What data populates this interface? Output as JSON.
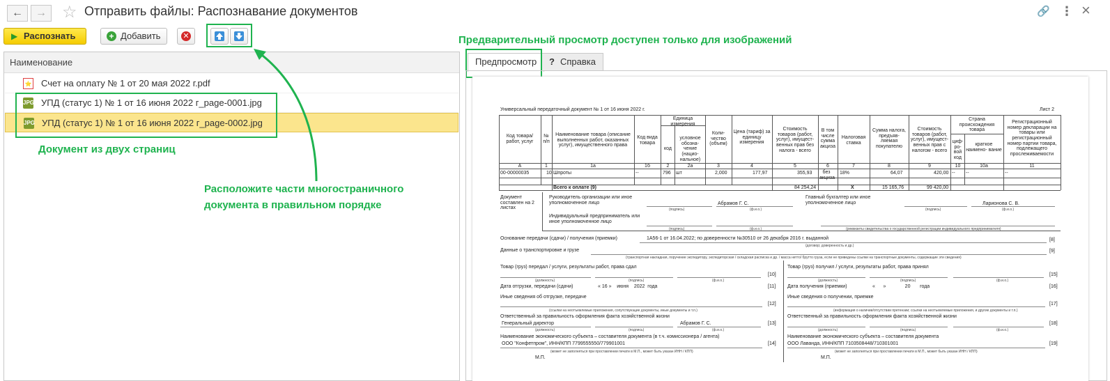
{
  "window": {
    "title": "Отправить файлы: Распознавание документов",
    "back_icon": "←",
    "forward_icon": "→",
    "star_icon": "☆",
    "link_icon": "🔗",
    "menu_icon": "⋮",
    "close_icon": "×"
  },
  "toolbar": {
    "recognize_label": "Распознать",
    "add_label": "Добавить"
  },
  "list": {
    "column_header": "Наименование",
    "rows": [
      {
        "name": "Счет на оплату № 1 от 20 мая 2022 г.pdf",
        "type": "pdf"
      },
      {
        "name": "УПД (статус 1) № 1 от 16 июня 2022 г_page-0001.jpg",
        "type": "jpg"
      },
      {
        "name": "УПД (статус 1) № 1 от 16 июня 2022 г_page-0002.jpg",
        "type": "jpg"
      }
    ]
  },
  "annotations": {
    "two_pages": "Документ из двух страниц",
    "order_line1": "Расположите части многостраничного",
    "order_line2": "документа в правильном порядке",
    "preview_note": "Предварительный просмотр доступен только для изображений"
  },
  "tabs": {
    "preview": "Предпросмотр",
    "help_icon": "?",
    "help": "Справка"
  },
  "doc": {
    "title": "Универсальный передаточный документ № 1 от 16 июня 2022 г.",
    "sheet": "Лист 2",
    "headers": [
      "Код товара/ работ, услуг",
      "№ п/п",
      "Наименование товара (описание выполненных работ, оказанных услуг), имущественного права",
      "Код вида товара",
      "Единица измерения",
      "код",
      "условное обозна- чение (нацио- нальное)",
      "Коли- чество (объем)",
      "Цена (тариф) за единицу измерения",
      "Стоимость товаров (работ, услуг), имущест- венных прав без налога - всего",
      "В том числе сумма акциза",
      "Налоговая ставка",
      "Сумма налога, предъяв- ляемая покупателю",
      "Стоимость товаров (работ, услуг), имущест- венных прав с налогом - всего",
      "Страна происхождения товара",
      "циф- ро- вой код",
      "краткое наимено- вание",
      "Регистрационный номер декларации на товары или регистрационный номер партии товара, подлежащего прослеживаемости"
    ],
    "col_letters": [
      "А",
      "1",
      "1а",
      "1б",
      "2",
      "2а",
      "3",
      "4",
      "5",
      "6",
      "7",
      "8",
      "9",
      "10",
      "10а",
      "11"
    ],
    "row": [
      "00-00000035",
      "10",
      "Шпроты",
      "--",
      "796",
      "шт",
      "2,000",
      "177,97",
      "355,93",
      "без акциза",
      "18%",
      "64,07",
      "420,00",
      "--",
      "--",
      "--"
    ],
    "total_label": "Всего к оплате (9)",
    "total_values": [
      "84 254,24",
      "X",
      "15 165,76",
      "99 420,00"
    ],
    "sign_left": "Документ составлен на 2 листах",
    "head_org": "Руководитель организации или иное уполномоченное лицо",
    "head_name": "Абрамов Г. С.",
    "chief_acc": "Главный бухгалтер или иное уполномоченное лицо",
    "chief_name": "Ларионова С. В.",
    "ip": "Индивидуальный предприниматель или иное уполномоченное лицо",
    "podpis": "(подпись)",
    "fio": "(ф.и.о.)",
    "rekv": "(реквизиты свидетельства о государственной регистрации индивидуального предпринимателя)",
    "basis_label": "Основание передачи (сдачи) / получения (приемки)",
    "basis_value": "1А56-1 от 16.04.2022; по доверенности №30510 от 26 декабря 2016 г. выданной",
    "basis_note": "(договор; доверенность и др.)",
    "transport_label": "Данные о транспортировке и грузе",
    "transport_note": "(транспортная накладная, поручение экспедитору, экспедиторская / складская расписка и др. / масса нетто/ брутто груза, если не приведены ссылки на транспортные документы, содержащие эти сведения)",
    "n8": "[8]",
    "n9": "[9]",
    "n10": "[10]",
    "n11": "[11]",
    "n12": "[12]",
    "n13": "[13]",
    "n14": "[14]",
    "n15": "[15]",
    "n16": "[16]",
    "n17": "[17]",
    "n18": "[18]",
    "n19": "[19]",
    "given": "Товар (груз) передал / услуги, результаты работ, права сдал",
    "received": "Товар (груз) получил / услуги, результаты работ, права принял",
    "dolzh": "(должность)",
    "ship_date_label": "Дата отгрузки, передачи (сдачи)",
    "ship_date_value": "« 16 »    июня    2022  года",
    "recv_date_label": "Дата получения (приемки)",
    "recv_date_value": "«      »              20       года",
    "other_ship": "Иные сведения об отгрузке, передаче",
    "other_ship_note": "(ссылки на неотъемлемые приложения, сопутствующие документы, иные документы и т.п.)",
    "other_recv": "Иные сведения о получении, приемке",
    "other_recv_note": "(информация о наличии/отсутствии претензии; ссылки на неотъемлемые приложения, и другие документы и т.п.)",
    "resp": "Ответственный за правильность оформления факта хозяйственной жизни",
    "resp_pos": "Генеральный директор",
    "resp_name": "Абрамов Г. С.",
    "entity": "Наименование экономического субъекта – составителя документа (в т.ч. комиссионера / агента)",
    "entity_value": "ООО \"Конфетпром\", ИНН/КПП 7799555550/779901001",
    "entity_r": "Наименование экономического субъекта – составителя документа",
    "entity_r_value": "ООО Лаванда, ИНН/КПП 7103508448/710301001",
    "entity_note": "(может не заполняться при проставлении печати в М.П., может быть указан ИНН / КПП)",
    "mp": "М.П."
  }
}
